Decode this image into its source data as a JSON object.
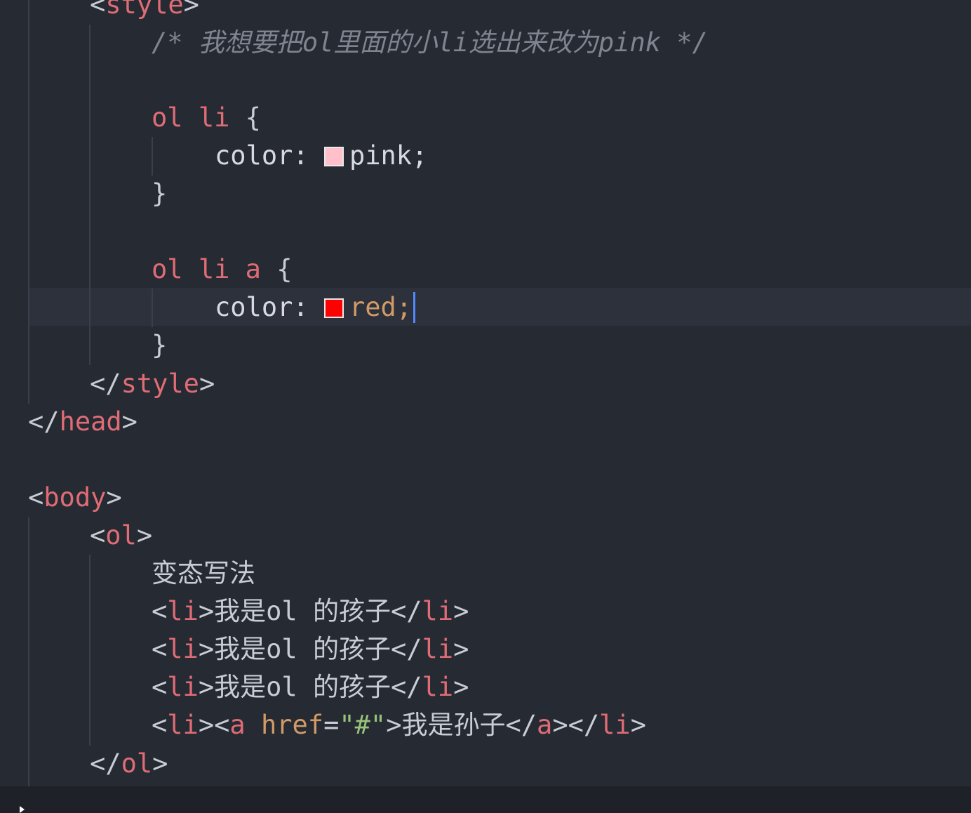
{
  "lines": {
    "style_open": {
      "tag": "style"
    },
    "comment": "/* 我想要把ol里面的小li选出来改为pink */",
    "rule1": {
      "selector": "ol li",
      "brace_open": "{",
      "brace_close": "}",
      "property": "color:",
      "value": "pink;",
      "swatch_color": "#ffc0cb"
    },
    "rule2": {
      "selector": "ol li a",
      "brace_open": "{",
      "brace_close": "}",
      "property": "color:",
      "value": "red;",
      "swatch_color": "#ff0000"
    },
    "style_close": {
      "tag": "style"
    },
    "head_close": {
      "tag": "head"
    },
    "body_open": {
      "tag": "body"
    },
    "ol_open": {
      "tag": "ol"
    },
    "plain_text": "变态写法",
    "li_items": [
      {
        "tag": "li",
        "text": "我是ol 的孩子"
      },
      {
        "tag": "li",
        "text": "我是ol 的孩子"
      },
      {
        "tag": "li",
        "text": "我是ol 的孩子"
      }
    ],
    "li_link": {
      "li_tag": "li",
      "a_tag": "a",
      "attr": "href",
      "attr_value": "\"#\"",
      "text": "我是孙子"
    },
    "ol_close": {
      "tag": "ol"
    }
  }
}
